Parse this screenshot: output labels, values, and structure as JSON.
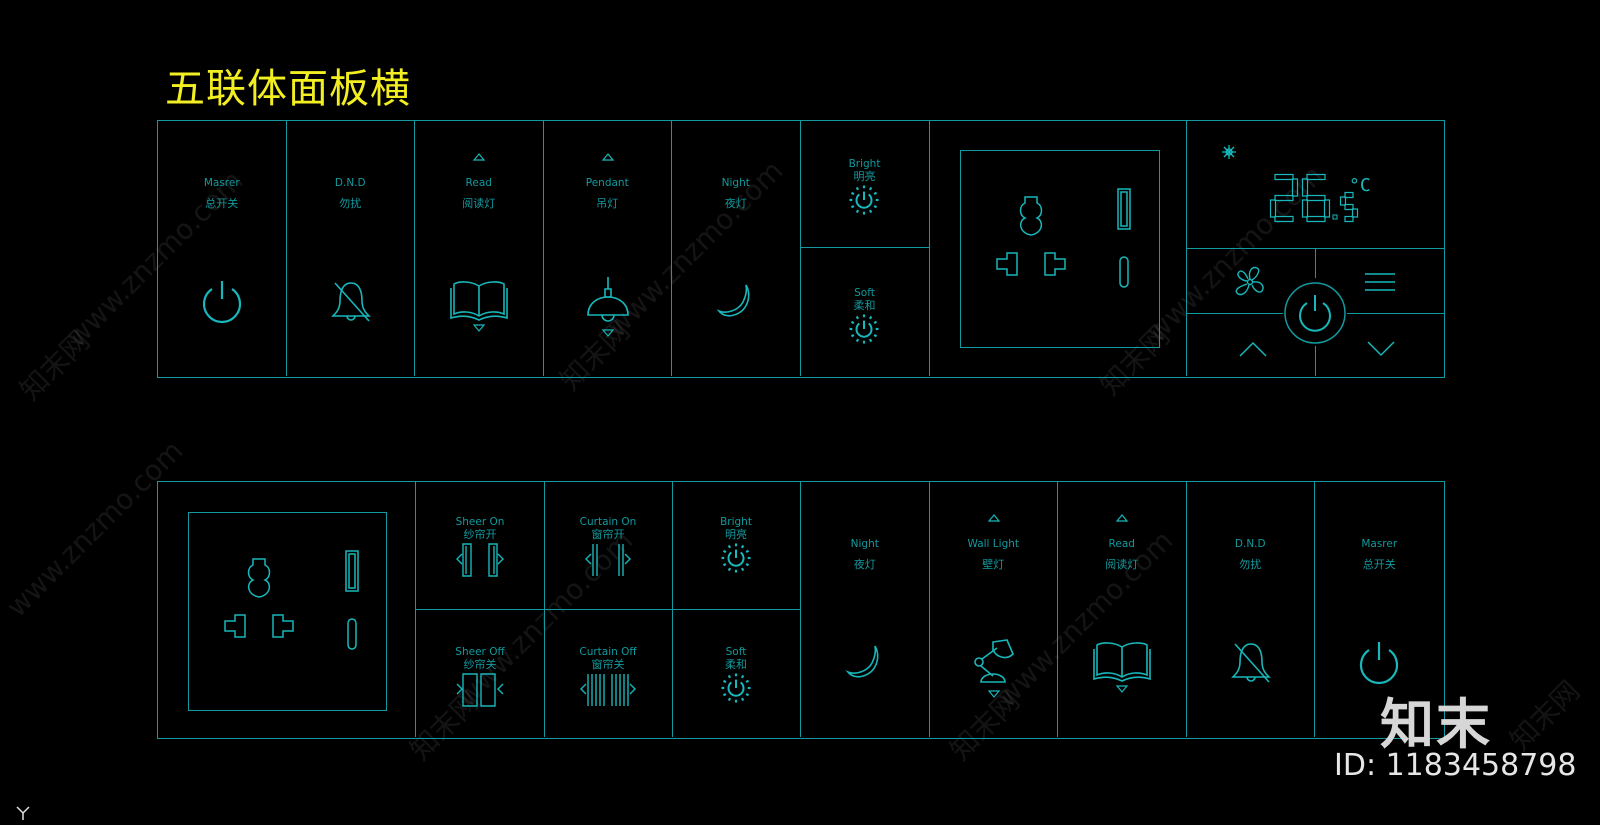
{
  "title": "五联体面板横",
  "colors": {
    "line": "#119a9f",
    "title": "#f2ee22",
    "background": "#000000"
  },
  "top_panel": {
    "switches": [
      {
        "en": "Masrer",
        "cn": "总开关",
        "icon": "power-icon",
        "arrows": false
      },
      {
        "en": "D.N.D",
        "cn": "勿扰",
        "icon": "bell-off-icon",
        "arrows": false
      },
      {
        "en": "Read",
        "cn": "阅读灯",
        "icon": "book-icon",
        "arrows": true
      },
      {
        "en": "Pendant",
        "cn": "吊灯",
        "icon": "pendant-lamp-icon",
        "arrows": true
      },
      {
        "en": "Night",
        "cn": "夜灯",
        "icon": "moon-icon",
        "arrows": false
      }
    ],
    "dimmer": [
      {
        "en": "Bright",
        "cn": "明亮",
        "icon": "dimmer-bright-icon"
      },
      {
        "en": "Soft",
        "cn": "柔和",
        "icon": "dimmer-soft-icon"
      }
    ],
    "socket": {
      "icon": "universal-socket-icon",
      "usb_a": "usb-a-port-icon",
      "usb_c": "usb-c-port-icon"
    },
    "thermostat": {
      "temperature": "26.5",
      "unit": "°C",
      "mode_icon": "snowflake-icon",
      "buttons": [
        "fan-icon",
        "menu-icon",
        "power-icon",
        "up-chevron-icon",
        "down-chevron-icon"
      ]
    }
  },
  "bottom_panel": {
    "socket": {
      "icon": "universal-socket-icon",
      "usb_a": "usb-a-port-icon",
      "usb_c": "usb-c-port-icon"
    },
    "curtain_grid": [
      {
        "en": "Sheer On",
        "cn": "纱帘开",
        "icon": "sheer-open-icon"
      },
      {
        "en": "Curtain On",
        "cn": "窗帘开",
        "icon": "curtain-open-icon"
      },
      {
        "en": "Bright",
        "cn": "明亮",
        "icon": "dimmer-bright-icon"
      },
      {
        "en": "Sheer Off",
        "cn": "纱帘关",
        "icon": "sheer-close-icon"
      },
      {
        "en": "Curtain Off",
        "cn": "窗帘关",
        "icon": "curtain-close-icon"
      },
      {
        "en": "Soft",
        "cn": "柔和",
        "icon": "dimmer-soft-icon"
      }
    ],
    "switches": [
      {
        "en": "Night",
        "cn": "夜灯",
        "icon": "moon-icon",
        "arrows": false
      },
      {
        "en": "Wall Light",
        "cn": "壁灯",
        "icon": "wall-lamp-icon",
        "arrows": true
      },
      {
        "en": "Read",
        "cn": "阅读灯",
        "icon": "book-icon",
        "arrows": true
      },
      {
        "en": "D.N.D",
        "cn": "勿扰",
        "icon": "bell-off-icon",
        "arrows": false
      },
      {
        "en": "Masrer",
        "cn": "总开关",
        "icon": "power-icon",
        "arrows": false
      }
    ]
  },
  "watermark": {
    "site": "www.znzmo.com",
    "brand_cn": "知末网",
    "logo": "知末",
    "id_label": "ID: 1183458798"
  }
}
